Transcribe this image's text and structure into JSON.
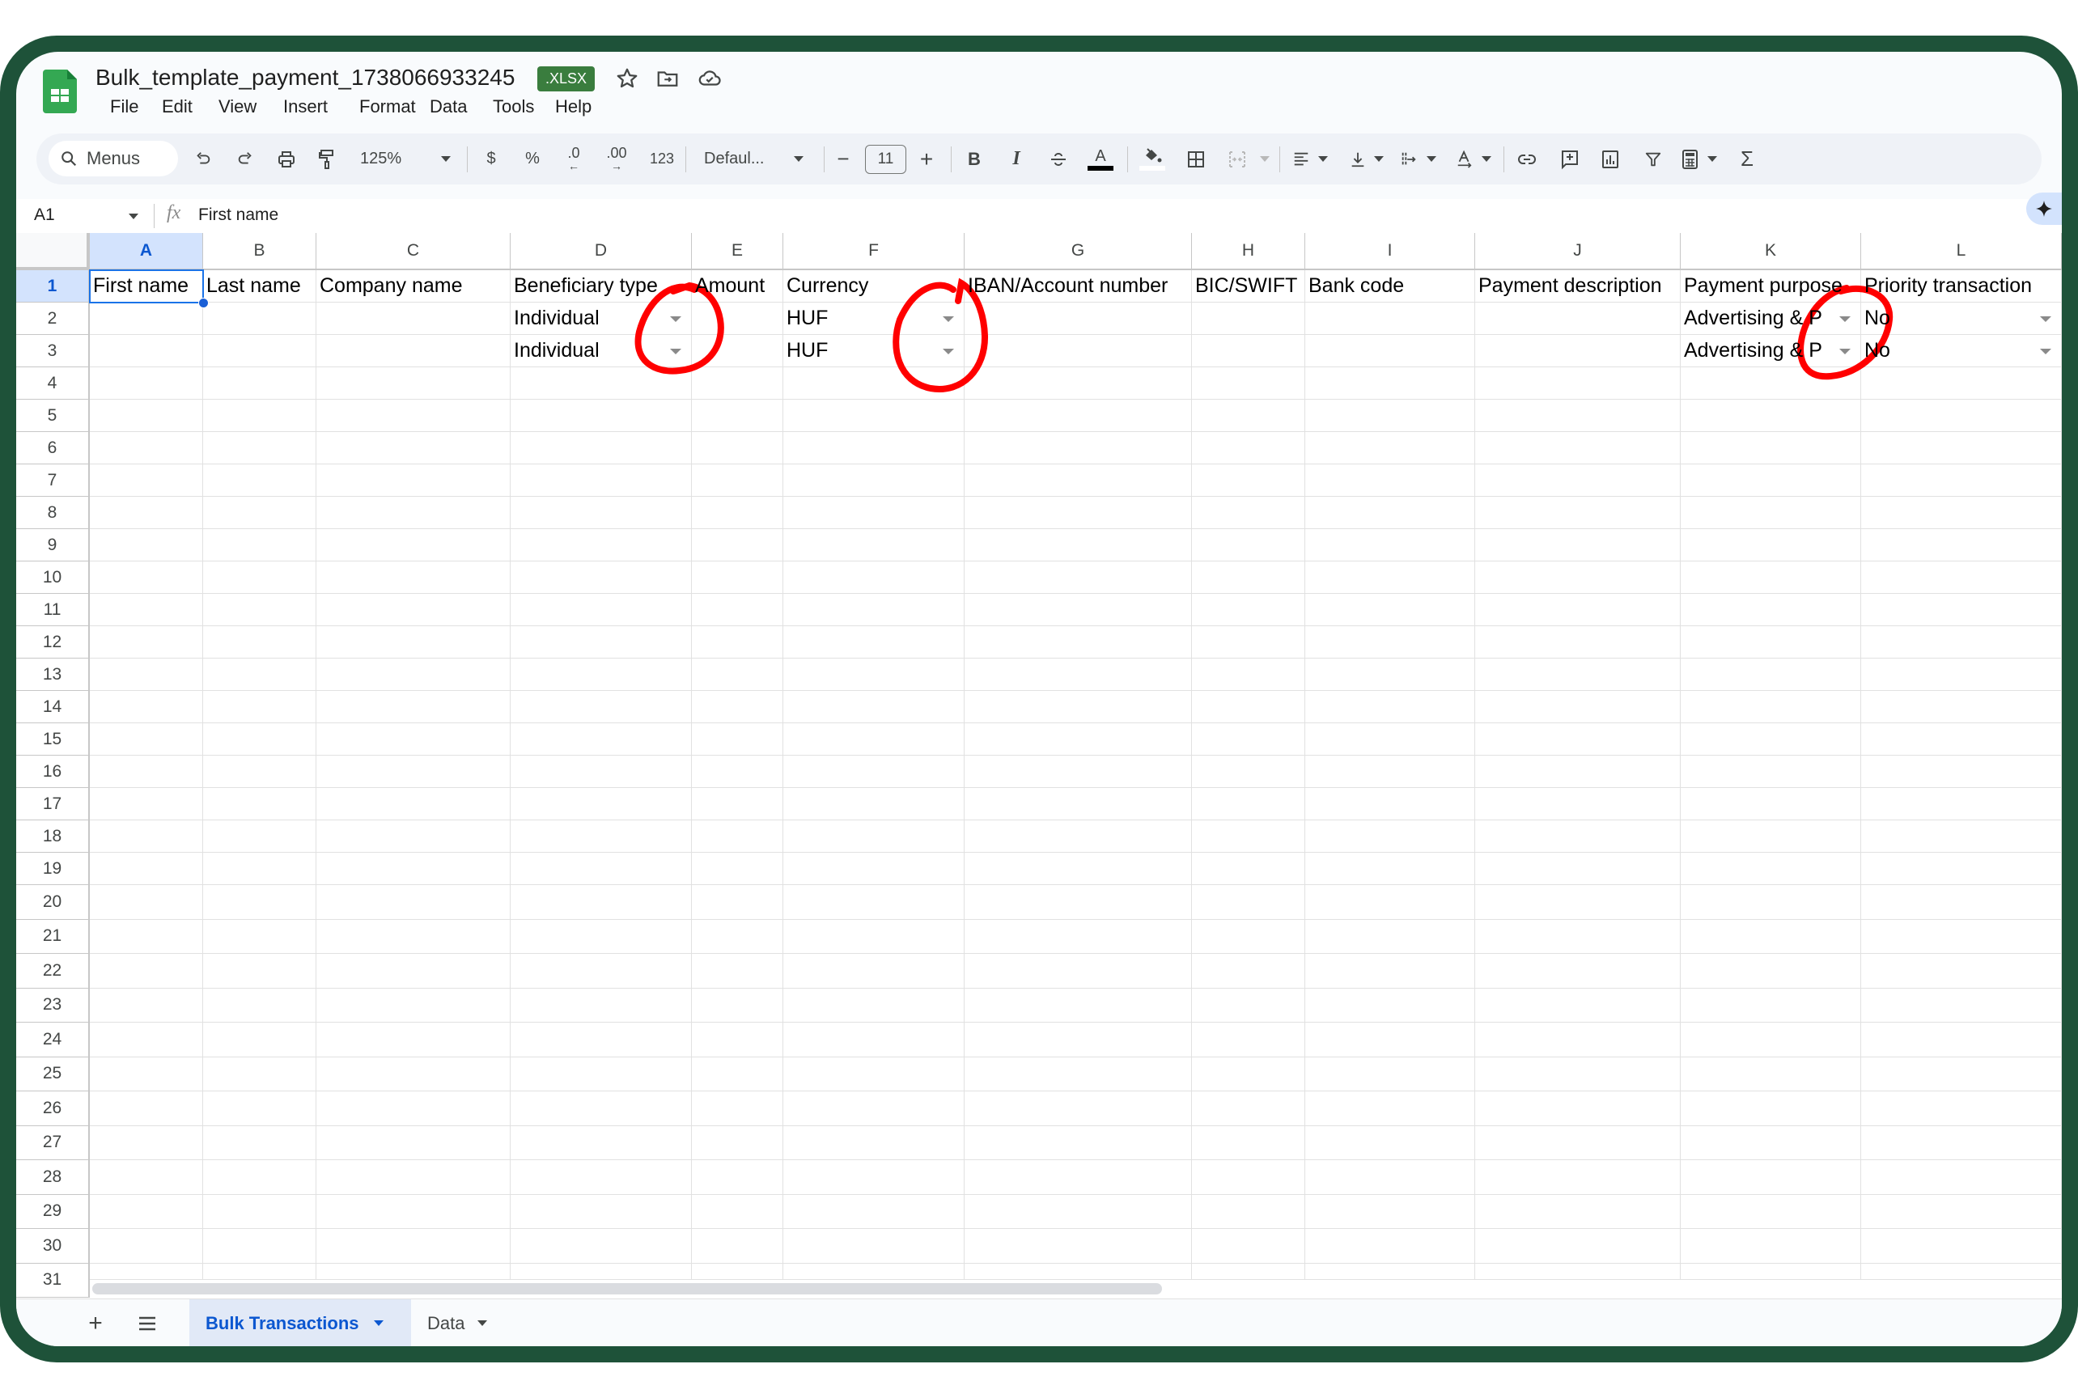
{
  "app": {
    "file_name": "Bulk_template_payment_1738066933245",
    "file_badge": ".XLSX",
    "header_icons": [
      "star-icon",
      "move-to-folder-icon",
      "cloud-saved-icon"
    ]
  },
  "menubar": [
    "File",
    "Edit",
    "View",
    "Insert",
    "Format",
    "Data",
    "Tools",
    "Help"
  ],
  "toolbar": {
    "search_label": "Menus",
    "zoom": "125%",
    "currency": "$",
    "percent": "%",
    "decrease_decimal": ".0",
    "increase_decimal": ".00",
    "number_format": "123",
    "font": "Defaul...",
    "font_size": "11",
    "bold": "B",
    "italic": "I",
    "text_color_letter": "A",
    "sigma": "Σ"
  },
  "formula_bar": {
    "name_box": "A1",
    "fx": "fx",
    "content": "First name"
  },
  "columns": [
    "A",
    "B",
    "C",
    "D",
    "E",
    "F",
    "G",
    "H",
    "I",
    "J",
    "K",
    "L"
  ],
  "selected_cell": "A1",
  "rows": [
    {
      "num": "1",
      "cells": [
        "First name",
        "Last name",
        "Company name",
        "Beneficiary type",
        "Amount",
        "Currency",
        "IBAN/Account number",
        "BIC/SWIFT",
        "Bank code",
        "Payment description",
        "Payment purpose",
        "Priority transaction"
      ]
    },
    {
      "num": "2",
      "cells": [
        "",
        "",
        "",
        "Individual",
        "",
        "HUF",
        "",
        "",
        "",
        "",
        "Advertising & P",
        "No"
      ]
    },
    {
      "num": "3",
      "cells": [
        "",
        "",
        "",
        "Individual",
        "",
        "HUF",
        "",
        "",
        "",
        "",
        "Advertising & P",
        "No"
      ]
    }
  ],
  "dropdown_columns": [
    "D",
    "F",
    "K",
    "L"
  ],
  "row_numbers": [
    "1",
    "2",
    "3",
    "4",
    "5",
    "6",
    "7",
    "8",
    "9",
    "10",
    "11",
    "12",
    "13",
    "14",
    "15",
    "16",
    "17",
    "18",
    "19",
    "20",
    "21",
    "22",
    "23",
    "24",
    "25",
    "26",
    "27",
    "28",
    "29",
    "30",
    "31"
  ],
  "sheet_tabs": [
    {
      "label": "Bulk Transactions",
      "active": true
    },
    {
      "label": "Data",
      "active": false
    }
  ],
  "annotations": {
    "color": "#ff0000",
    "circled": [
      "D2:D3 dropdown arrows",
      "F2:F3 dropdown arrows",
      "K2:K3 dropdown arrows"
    ]
  },
  "colors": {
    "frame": "#1e5239",
    "badge": "#3a7d3e",
    "selection": "#1a73e8",
    "active_tab_text": "#0b57d0",
    "active_tab_bg": "#e1e9f7"
  }
}
